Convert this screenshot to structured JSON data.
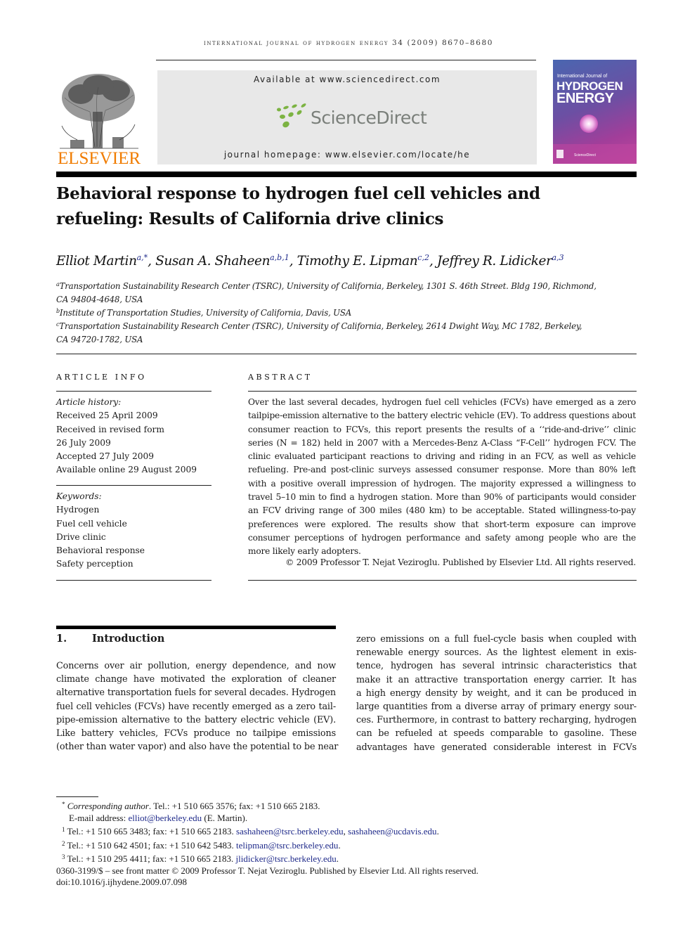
{
  "journal": {
    "running_head": "International Journal of Hydrogen Energy 34 (2009) 8670–8680",
    "publisher_wordmark": "ELSEVIER",
    "available_at": "Available at www.sciencedirect.com",
    "platform_name": "ScienceDirect",
    "homepage": "journal homepage: www.elsevier.com/locate/he",
    "cover": {
      "line1": "International Journal of",
      "line2": "HYDROGEN",
      "line3": "ENERGY",
      "footer": "ScienceDirect"
    },
    "colors": {
      "elsevier_orange": "#f07c00",
      "sd_green": "#7cb342",
      "sd_gray": "#7a7f7a",
      "link_blue": "#1f2a8a"
    }
  },
  "article": {
    "title": "Behavioral response to hydrogen fuel cell vehicles and refueling: Results of California drive clinics",
    "authors": [
      {
        "name": "Elliot Martin",
        "marks": "a,*"
      },
      {
        "name": "Susan A. Shaheen",
        "marks": "a,b,1"
      },
      {
        "name": "Timothy E. Lipman",
        "marks": "c,2"
      },
      {
        "name": "Jeffrey R. Lidicker",
        "marks": "a,3"
      }
    ],
    "affiliations": [
      {
        "mark": "a",
        "line1": "Transportation Sustainability Research Center (TSRC), University of California, Berkeley, 1301 S. 46th Street. Bldg 190, Richmond,",
        "line2": "CA 94804-4648, USA"
      },
      {
        "mark": "b",
        "line1": "Institute of Transportation Studies, University of California, Davis, USA"
      },
      {
        "mark": "c",
        "line1": "Transportation Sustainability Research Center (TSRC), University of California, Berkeley, 2614 Dwight Way, MC 1782, Berkeley,",
        "line2": "CA 94720-1782, USA"
      }
    ]
  },
  "article_info": {
    "heading": "ARTICLE INFO",
    "history_label": "Article history:",
    "history": [
      "Received 25 April 2009",
      "Received in revised form",
      "26 July 2009",
      "Accepted 27 July 2009",
      "Available online 29 August 2009"
    ],
    "keywords_label": "Keywords:",
    "keywords": [
      "Hydrogen",
      "Fuel cell vehicle",
      "Drive clinic",
      "Behavioral response",
      "Safety perception"
    ]
  },
  "abstract": {
    "heading": "ABSTRACT",
    "text": "Over the last several decades, hydrogen fuel cell vehicles (FCVs) have emerged as a zero tailpipe-emission alternative to the battery electric vehicle (EV). To address questions about consumer reaction to FCVs, this report presents the results of a ‘‘ride-and-drive’’ clinic series (N = 182) held in 2007 with a Mercedes-Benz A-Class “F-Cell’’ hydrogen FCV. The clinic evaluated participant reactions to driving and riding in an FCV, as well as vehicle refueling. Pre-and post-clinic surveys assessed consumer response. More than 80% left with a positive overall impression of hydrogen. The majority expressed a willingness to travel 5–10 min to find a hydrogen station. More than 90% of participants would consider an FCV driving range of 300 miles (480 km) to be acceptable. Stated willingness-to-pay preferences were explored. The results show that short-term exposure can improve consumer perceptions of hydrogen performance and safety among people who are the more likely early adopters.",
    "copyright": "© 2009 Professor T. Nejat Veziroglu. Published by Elsevier Ltd. All rights reserved."
  },
  "introduction": {
    "number": "1.",
    "title": "Introduction",
    "left_lines": [
      "Concerns over air pollution, energy dependence, and now",
      "climate change have motivated the exploration of cleaner",
      "alternative transportation fuels for several decades. Hydrogen",
      "fuel cell vehicles (FCVs) have recently emerged as a zero tail-",
      "pipe-emission alternative to the battery electric vehicle (EV).",
      "Like battery vehicles, FCVs produce no tailpipe emissions",
      "(other than water vapor) and also have the potential to be near"
    ],
    "right_lines": [
      "zero emissions on a full fuel-cycle basis when coupled with",
      "renewable energy sources. As the lightest element in exis-",
      "tence, hydrogen has several intrinsic characteristics that",
      "make it an attractive transportation energy carrier. It has",
      "a high energy density by weight, and it can be produced in",
      "large quantities from a diverse array of primary energy sour-",
      "ces. Furthermore, in contrast to battery recharging, hydrogen",
      "can be refueled at speeds comparable to gasoline. These",
      "advantages have generated considerable interest in FCVs"
    ]
  },
  "footnotes": {
    "corresponding_mark": "*",
    "corresponding_label": "Corresponding author",
    "corresponding_contact": ". Tel.: +1 510 665 3576; fax: +1 510 665 2183.",
    "email_label": "E-mail address: ",
    "email": "elliot@berkeley.edu",
    "email_suffix": " (E. Martin).",
    "notes": [
      {
        "mark": "1",
        "contact": "Tel.: +1 510 665 3483; fax: +1 510 665 2183. ",
        "emails": [
          "sashaheen@tsrc.berkeley.edu",
          "sashaheen@ucdavis.edu"
        ]
      },
      {
        "mark": "2",
        "contact": "Tel.: +1 510 642 4501; fax: +1 510 642 5483. ",
        "emails": [
          "telipman@tsrc.berkeley.edu"
        ]
      },
      {
        "mark": "3",
        "contact": "Tel.: +1 510 295 4411; fax: +1 510 665 2183. ",
        "emails": [
          "jlidicker@tsrc.berkeley.edu"
        ]
      }
    ],
    "front_matter": "0360-3199/$ – see front matter © 2009 Professor T. Nejat Veziroglu. Published by Elsevier Ltd. All rights reserved.",
    "doi": "doi:10.1016/j.ijhydene.2009.07.098"
  }
}
